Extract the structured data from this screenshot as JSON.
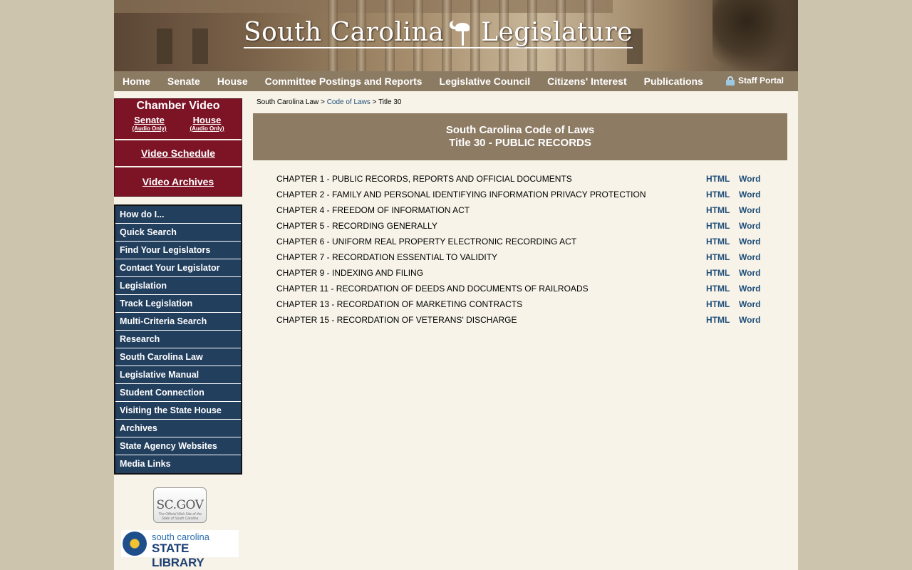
{
  "site": {
    "title_part1": "South Carolina",
    "title_part2": "Legislature"
  },
  "topnav": {
    "items": [
      "Home",
      "Senate",
      "House",
      "Committee Postings and Reports",
      "Legislative Council",
      "Citizens' Interest",
      "Publications"
    ],
    "staff_portal": "Staff Portal"
  },
  "chamber": {
    "title": "Chamber Video",
    "senate": "Senate",
    "senate_sub": "(Audio Only)",
    "house": "House",
    "house_sub": "(Audio Only)",
    "schedule": "Video Schedule",
    "archives": "Video Archives"
  },
  "sidenav": {
    "items": [
      "How do I...",
      "Quick Search",
      "Find Your Legislators",
      "Contact Your Legislator",
      "Legislation",
      "Track Legislation",
      "Multi-Criteria Search",
      "Research",
      "South Carolina Law",
      "Legislative Manual",
      "Student Connection",
      "Visiting the State House",
      "Archives",
      "State Agency Websites",
      "Media Links"
    ]
  },
  "logos": {
    "scgov": "SC.GOV",
    "scgov_tag": "The Official Web Site of the State of South Carolina",
    "library_line1": "south carolina",
    "library_line2": "STATE LIBRARY"
  },
  "breadcrumb": {
    "root": "South Carolina Law",
    "sep": " > ",
    "link": "Code of Laws",
    "current": "Title 30"
  },
  "main": {
    "heading1": "South Carolina Code of Laws",
    "heading2": "Title 30 - PUBLIC RECORDS",
    "html_label": "HTML",
    "word_label": "Word",
    "chapters": [
      "CHAPTER 1 - PUBLIC RECORDS, REPORTS AND OFFICIAL DOCUMENTS",
      "CHAPTER 2 - FAMILY AND PERSONAL IDENTIFYING INFORMATION PRIVACY PROTECTION",
      "CHAPTER 4 - FREEDOM OF INFORMATION ACT",
      "CHAPTER 5 - RECORDING GENERALLY",
      "CHAPTER 6 - UNIFORM REAL PROPERTY ELECTRONIC RECORDING ACT",
      "CHAPTER 7 - RECORDATION ESSENTIAL TO VALIDITY",
      "CHAPTER 9 - INDEXING AND FILING",
      "CHAPTER 11 - RECORDATION OF DEEDS AND DOCUMENTS OF RAILROADS",
      "CHAPTER 13 - RECORDATION OF MARKETING CONTRACTS",
      "CHAPTER 15 - RECORDATION OF VETERANS' DISCHARGE"
    ]
  },
  "colors": {
    "nav_bg": "#8c7b63",
    "chamber_bg": "#7d1426",
    "sidenav_bg": "#223f5e",
    "link": "#1f4e79",
    "page_bg": "#f7f3e8"
  }
}
